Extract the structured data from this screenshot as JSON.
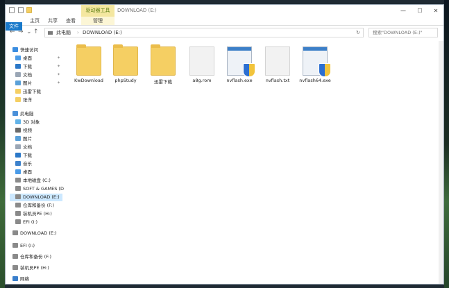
{
  "window": {
    "title": "DOWNLOAD (E:)",
    "context_group": "驱动器工具",
    "controls": [
      "—",
      "☐",
      "✕"
    ]
  },
  "ribbon": {
    "tabs": [
      "文件",
      "主页",
      "共享",
      "查看",
      "管理"
    ]
  },
  "address": {
    "back": "←",
    "forward": "→",
    "recent": "⌄",
    "up": "↑",
    "crumbs": [
      "此电脑",
      "DOWNLOAD (E:)"
    ],
    "refresh": "↻",
    "search_placeholder": "搜索\"DOWNLOAD (E:)\""
  },
  "nav": {
    "quick_access": "快速访问",
    "quick_items": [
      "桌面",
      "下载",
      "文档",
      "图片",
      "迅雷下载",
      "张洋"
    ],
    "this_pc": "此电脑",
    "pc_items": [
      "3D 对象",
      "视频",
      "图片",
      "文档",
      "下载",
      "音乐",
      "桌面",
      "本地磁盘 (C:)",
      "SOFT & GAMES (D",
      "DOWNLOAD (E:)",
      "仓库和备份 (F:)",
      "装机员PE (H:)",
      "EFI (I:)"
    ],
    "drives": [
      "DOWNLOAD (E:)",
      "EFI (I:)",
      "仓库和备份 (F:)",
      "装机员PE (H:)"
    ],
    "network": "网络"
  },
  "files": [
    {
      "name": "KwDownload",
      "kind": "folder"
    },
    {
      "name": "phpStudy",
      "kind": "folder"
    },
    {
      "name": "迅雷下载",
      "kind": "folder"
    },
    {
      "name": "a8g.rom",
      "kind": "doc"
    },
    {
      "name": "nvflash.exe",
      "kind": "exe"
    },
    {
      "name": "nvflash.txt",
      "kind": "doc"
    },
    {
      "name": "nvflash64.exe",
      "kind": "exe"
    }
  ],
  "colors": {
    "accent": "#1979ca",
    "folder": "#f5cf63",
    "selection": "#cce8ff",
    "context_tab": "#f4e7a0"
  }
}
